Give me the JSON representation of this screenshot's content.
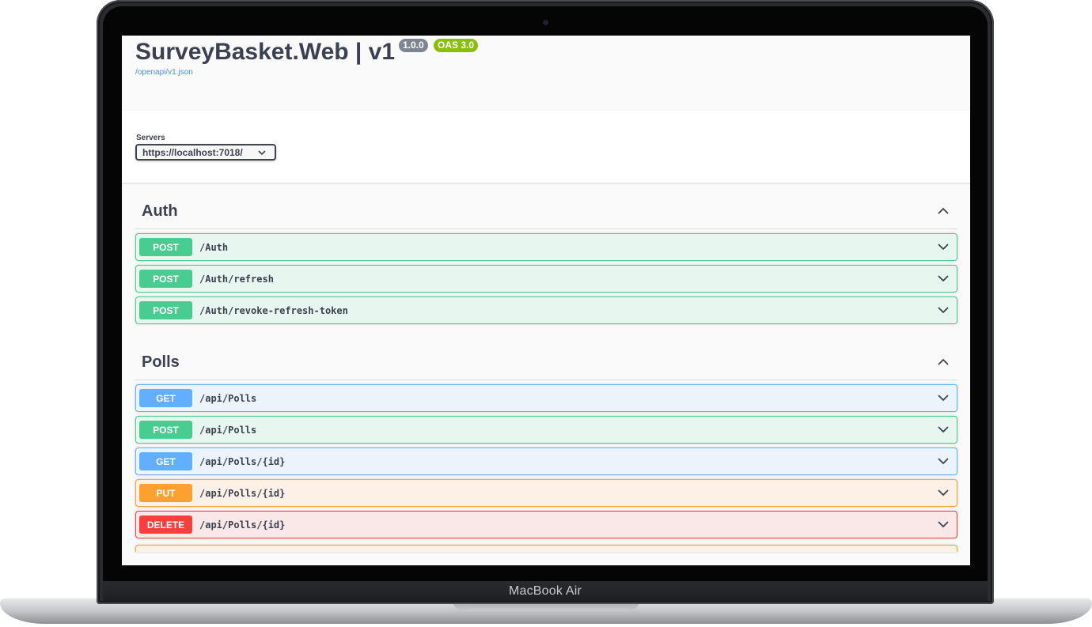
{
  "device": {
    "label": "MacBook Air"
  },
  "header": {
    "title": "SurveyBasket.Web | v1",
    "version_badge": "1.0.0",
    "oas_badge": "OAS 3.0",
    "spec_link": "/openapi/v1.json"
  },
  "servers": {
    "label": "Servers",
    "selected": "https://localhost:7018/"
  },
  "tags": [
    {
      "name": "Auth",
      "operations": [
        {
          "method": "POST",
          "path": "/Auth"
        },
        {
          "method": "POST",
          "path": "/Auth/refresh"
        },
        {
          "method": "POST",
          "path": "/Auth/revoke-refresh-token"
        }
      ]
    },
    {
      "name": "Polls",
      "operations": [
        {
          "method": "GET",
          "path": "/api/Polls"
        },
        {
          "method": "POST",
          "path": "/api/Polls"
        },
        {
          "method": "GET",
          "path": "/api/Polls/{id}"
        },
        {
          "method": "PUT",
          "path": "/api/Polls/{id}"
        },
        {
          "method": "DELETE",
          "path": "/api/Polls/{id}"
        }
      ]
    }
  ],
  "colors": {
    "post": "#49cc90",
    "get": "#61affe",
    "put": "#fca130",
    "delete": "#f93e3e",
    "version_badge": "#7d8492",
    "oas_badge": "#89bf04"
  },
  "icons": {
    "expand": "chevron-down-icon",
    "collapse": "chevron-up-icon",
    "select": "chevron-down-icon"
  }
}
